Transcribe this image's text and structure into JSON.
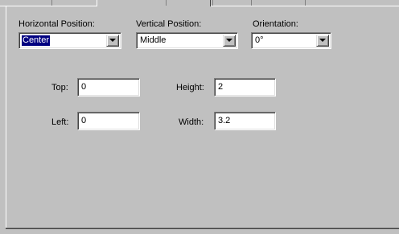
{
  "horizontal": {
    "label": "Horizontal Position:",
    "value": "Center"
  },
  "vertical": {
    "label": "Vertical Position:",
    "value": "Middle"
  },
  "orientation": {
    "label": "Orientation:",
    "value": "0°"
  },
  "top": {
    "label": "Top:",
    "value": "0"
  },
  "left": {
    "label": "Left:",
    "value": "0"
  },
  "height": {
    "label": "Height:",
    "value": "2"
  },
  "width": {
    "label": "Width:",
    "value": "3.2"
  }
}
